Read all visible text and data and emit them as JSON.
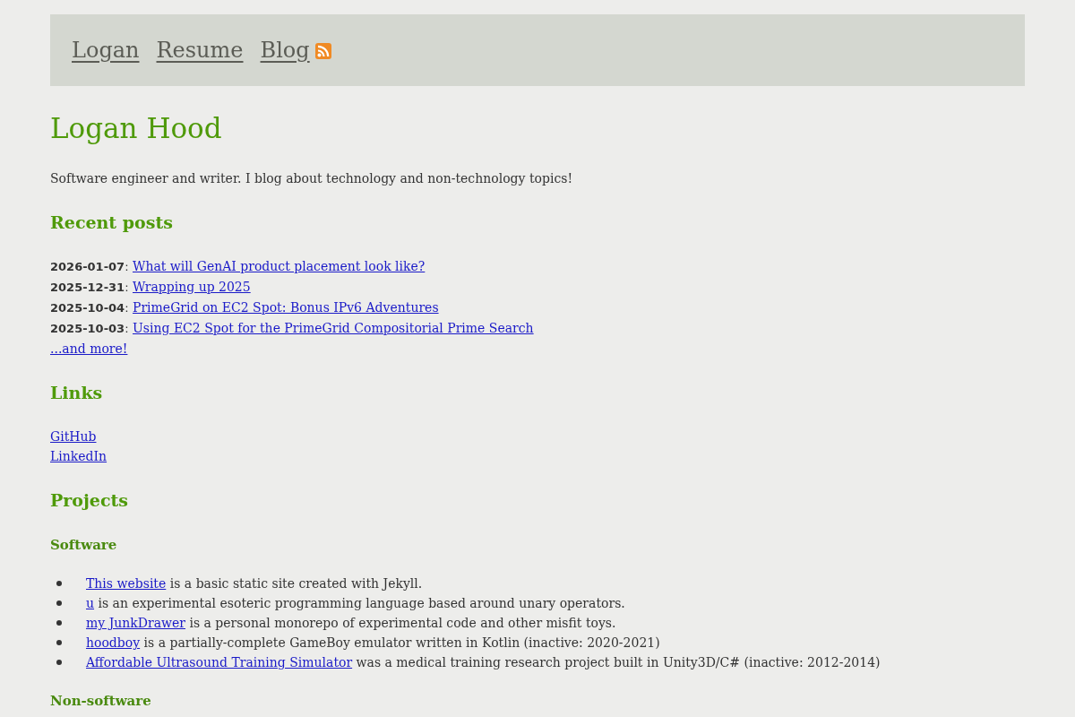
{
  "nav": {
    "items": [
      "Logan",
      "Resume",
      "Blog"
    ]
  },
  "title": "Logan Hood",
  "intro": "Software engineer and writer. I blog about technology and non-technology topics!",
  "recent_posts": {
    "heading": "Recent posts",
    "posts": [
      {
        "date": "**2026-01-07**:",
        "title": "What will GenAI product placement look like?"
      },
      {
        "date": "**2025-12-31**:",
        "title": "Wrapping up 2025"
      },
      {
        "date": "**2025-10-04**:",
        "title": "PrimeGrid on EC2 Spot: Bonus IPv6 Adventures"
      },
      {
        "date": "**2025-10-03**:",
        "title": "Using EC2 Spot for the PrimeGrid Compositorial Prime Search"
      }
    ],
    "more": "...and more!"
  },
  "links": {
    "heading": "Links",
    "items": [
      "GitHub",
      "LinkedIn"
    ]
  },
  "projects": {
    "heading": "Projects",
    "sections": [
      {
        "heading": "Software",
        "items": [
          {
            "link": "This website",
            "text": "is a basic static site created with Jekyll."
          },
          {
            "link": "u",
            "text": "is an experimental esoteric programming language based around unary operators."
          },
          {
            "link": "my JunkDrawer",
            "text": "is a personal monorepo of experimental code and other misfit toys."
          },
          {
            "link": "hoodboy",
            "text": "is a partially-complete GameBoy emulator written in Kotlin (inactive: 2020-2021)"
          },
          {
            "link": "Affordable Ultrasound Training Simulator",
            "text": "was a medical training research project built in Unity3D/C# (inactive: 2012-2014)"
          }
        ]
      },
      {
        "heading": "Non-software"
      }
    ]
  }
}
